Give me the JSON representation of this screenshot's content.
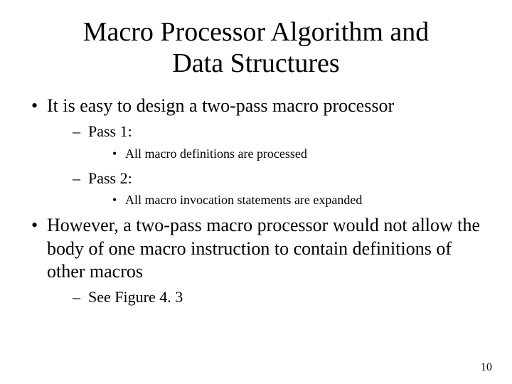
{
  "title_line1": "Macro Processor Algorithm and",
  "title_line2": "Data Structures",
  "b1": "It is easy to design a two-pass macro processor",
  "b1_s1": "Pass 1:",
  "b1_s1_d1": "All macro definitions are processed",
  "b1_s2": "Pass 2:",
  "b1_s2_d1": "All macro invocation statements are expanded",
  "b2": "However, a two-pass macro processor would not allow the body of one macro instruction to contain definitions of other macros",
  "b2_s1": "See Figure 4. 3",
  "page_number": "10"
}
